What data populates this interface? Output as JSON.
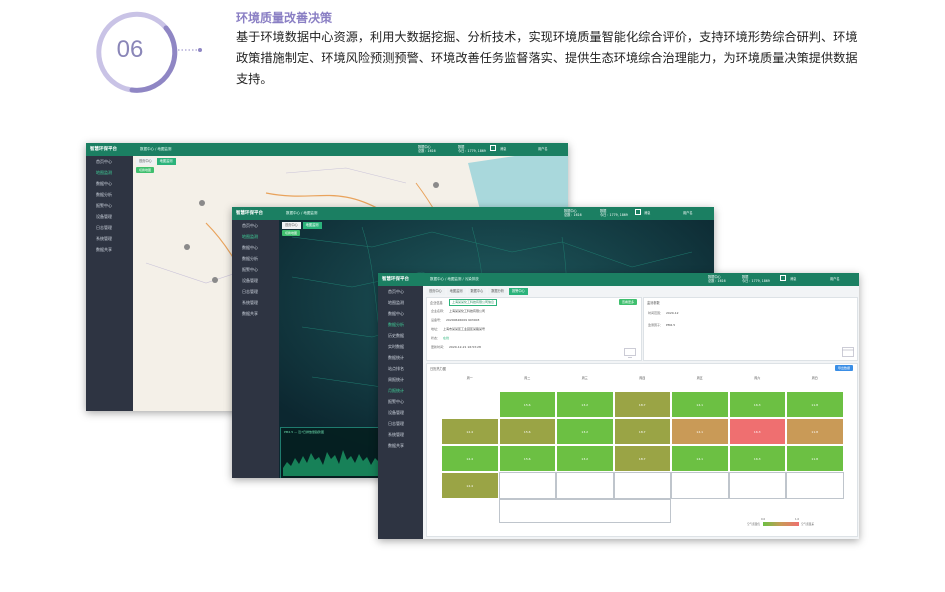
{
  "header": {
    "number": "06",
    "title": "环境质量改善决策",
    "description": "基于环境数据中心资源，利用大数据挖掘、分析技术，实现环境质量智能化综合评价，支持环境形势综合研判、环境政策措施制定、环境风险预测预警、环境改善任务监督落实、提供生态环境综合治理能力，为环境质量决策提供数据支持。"
  },
  "app": {
    "name": "智慧环保平台",
    "crumb_home": "数据中心",
    "crumb_map": "地图监测",
    "crumb_page3": "污染排放",
    "top_stat_1a": "数据中心",
    "top_stat_1b": "总数：1616",
    "top_stat_2a": "数据",
    "top_stat_2b": "今日：1779, 1869",
    "notice_label": "消息",
    "user_label": "用户名",
    "sidebar": [
      "首页中心",
      "地图监测",
      "数据中心",
      "数据分析",
      "报警中心",
      "设备管理",
      "日志管理",
      "系统管理",
      "数据共享"
    ],
    "sidebar_extra": [
      "历史数据",
      "实时数据",
      "数据统计",
      "站点排名",
      "周报统计",
      "月报统计"
    ],
    "tabs_1": [
      "首页中心",
      "地图监测"
    ],
    "tabs_3": [
      "首页中心",
      "地图监测",
      "数据中心",
      "数据分析",
      "报警中心"
    ],
    "map_button": "切换地图",
    "chart_caption": "PM2.5 — 近7日排放量趋势图",
    "panel1_title": "企业信息",
    "panel1_tag": "上海某某化工科技有限公司信息",
    "panel1_button": "查看更多",
    "panel1_rows": [
      {
        "label": "企业名称：",
        "value": "上海某某化工科技有限公司"
      },
      {
        "label": "设备号：",
        "value": "20200626009 903003"
      },
      {
        "label": "地址：",
        "value": "上海市某某区工业园区某路某号"
      },
      {
        "label": "状态：",
        "value": "在线"
      },
      {
        "label": "更新时间：",
        "value": "2020-12-21 16:53:28"
      }
    ],
    "panel2_title": "监测参数",
    "panel2_rows": [
      {
        "label": "时间范围：",
        "value": "2020-12"
      },
      {
        "label": "监测因子：",
        "value": "PM2.5"
      }
    ],
    "heat_title": "日历热力图",
    "heat_button": "导出数据",
    "weekdays": [
      "周一",
      "周二",
      "周三",
      "周四",
      "周五",
      "周六",
      "周日"
    ],
    "heat_colors": {
      "good": "#6cc043",
      "mid": "#9aa445",
      "warm": "#c99a57",
      "bad": "#ef6f70"
    },
    "legend_low": "0.0",
    "legend_high": "1.0",
    "legend_label_low": "空气质量优",
    "legend_label_high": "空气质量差"
  }
}
